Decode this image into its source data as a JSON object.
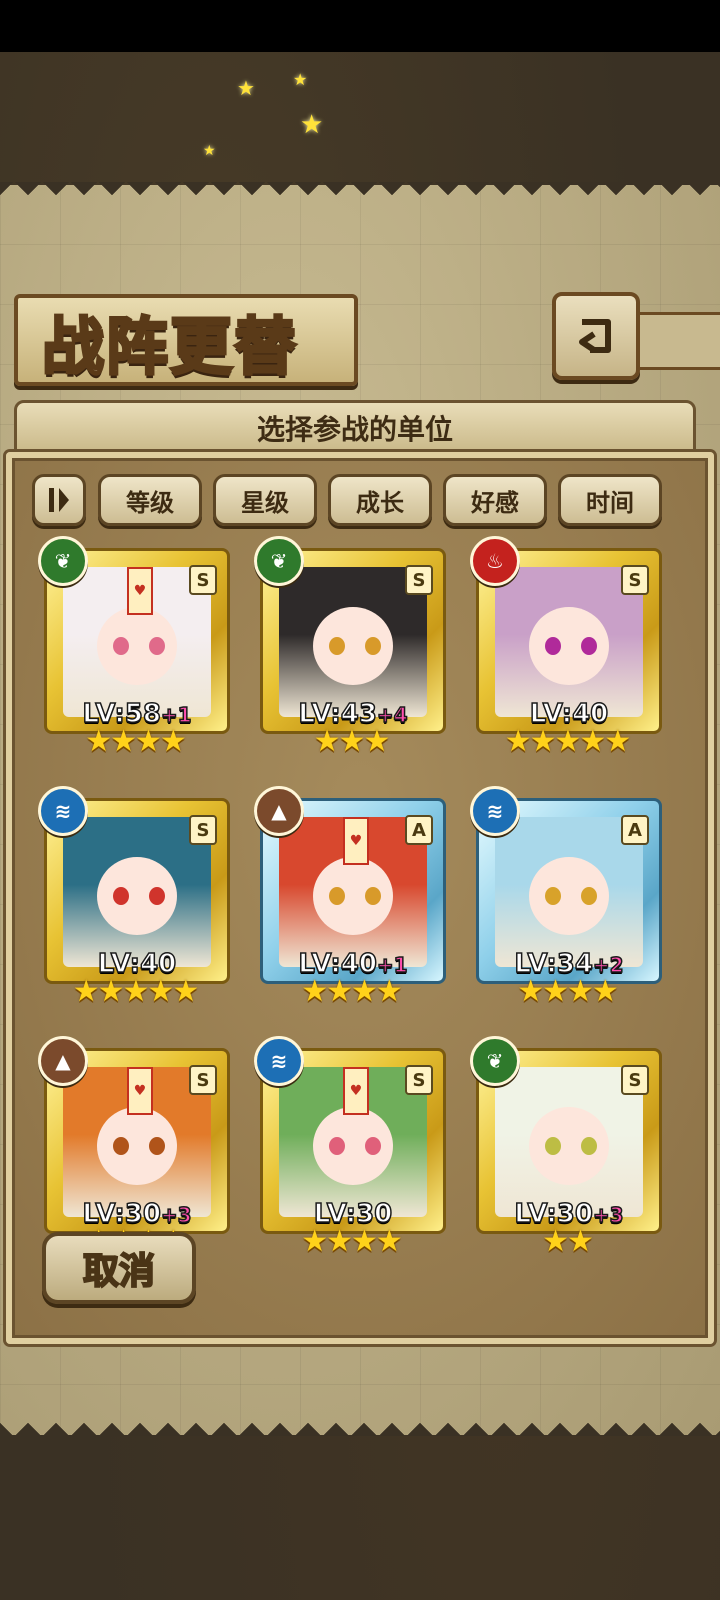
{
  "screen": {
    "title": "战阵更替",
    "subtitle": "选择参战的单位",
    "back_icon": "return-arrow-icon",
    "cancel_label": "取消"
  },
  "sort_buttons": [
    {
      "label": "",
      "icon": "sort-toggle-icon"
    },
    {
      "label": "等级"
    },
    {
      "label": "星级"
    },
    {
      "label": "成长"
    },
    {
      "label": "好感"
    },
    {
      "label": "时间"
    }
  ],
  "units": [
    {
      "element": "grass",
      "element_icon": "leaf-icon",
      "rank": "S",
      "frame": "gold",
      "level": "LV:58",
      "bonus": "+1",
      "stars": "★★★★",
      "hair": "#f4eef0",
      "eyes": "#e06a8a",
      "sealed": true
    },
    {
      "element": "grass",
      "element_icon": "leaf-icon",
      "rank": "S",
      "frame": "gold",
      "level": "LV:43",
      "bonus": "+4",
      "stars": "★★★",
      "hair": "#2e2a2a",
      "eyes": "#d89a2a",
      "sealed": false
    },
    {
      "element": "fire",
      "element_icon": "flame-icon",
      "rank": "S",
      "frame": "gold",
      "level": "LV:40",
      "bonus": "",
      "stars": "★★★★★",
      "hair": "#c9a0c8",
      "eyes": "#b02a9a",
      "sealed": false
    },
    {
      "element": "water",
      "element_icon": "water-wave-icon",
      "rank": "S",
      "frame": "gold",
      "level": "LV:40",
      "bonus": "",
      "stars": "★★★★★",
      "hair": "#2c6f86",
      "eyes": "#d0342c",
      "sealed": false
    },
    {
      "element": "earth",
      "element_icon": "mountain-icon",
      "rank": "A",
      "frame": "blue",
      "level": "LV:40",
      "bonus": "+1",
      "stars": "★★★★",
      "hair": "#d8482e",
      "eyes": "#d89a2a",
      "sealed": true
    },
    {
      "element": "water",
      "element_icon": "water-wave-icon",
      "rank": "A",
      "frame": "blue",
      "level": "LV:34",
      "bonus": "+2",
      "stars": "★★★★",
      "hair": "#a9d8ea",
      "eyes": "#d8a22a",
      "sealed": false
    },
    {
      "element": "earth",
      "element_icon": "mountain-icon",
      "rank": "S",
      "frame": "gold",
      "level": "LV:30",
      "bonus": "+3",
      "stars": "★★★★",
      "hair": "#e27a2a",
      "eyes": "#b0541a",
      "sealed": true
    },
    {
      "element": "water",
      "element_icon": "water-wave-icon",
      "rank": "S",
      "frame": "gold",
      "level": "LV:30",
      "bonus": "",
      "stars": "★★★★",
      "hair": "#6fae5a",
      "eyes": "#e0607a",
      "sealed": true
    },
    {
      "element": "grass",
      "element_icon": "leaf-icon",
      "rank": "S",
      "frame": "gold",
      "level": "LV:30",
      "bonus": "+3",
      "stars": "★★",
      "hair": "#f0f3e6",
      "eyes": "#bdbd44",
      "sealed": false
    }
  ],
  "colors": {
    "grass": "#2f7a2c",
    "fire": "#c4221e",
    "water": "#1d6fb5",
    "earth": "#7b4a2c",
    "star": "#ffd21a",
    "bonus": "#ff4fae"
  }
}
